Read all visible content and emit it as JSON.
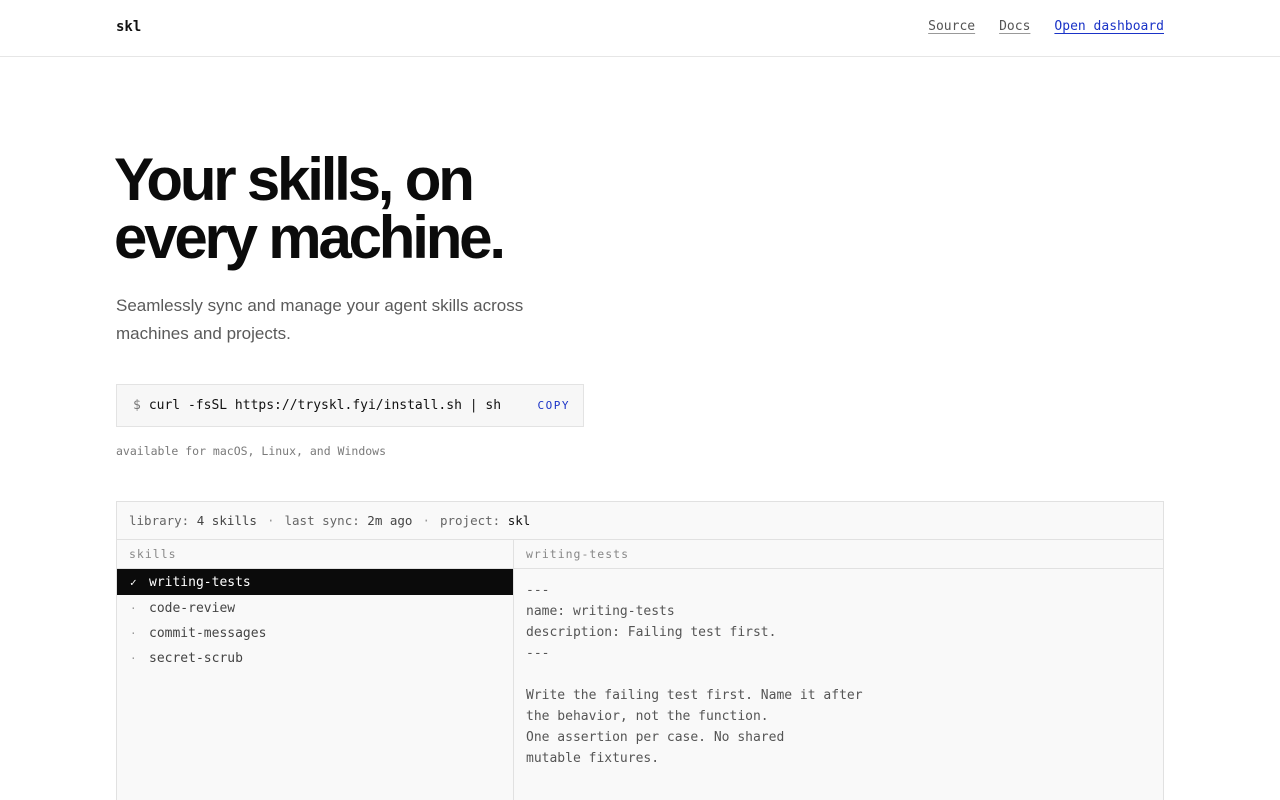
{
  "header": {
    "brand": "skl",
    "nav": [
      {
        "label": "Source"
      },
      {
        "label": "Docs"
      },
      {
        "label": "Open dashboard"
      }
    ]
  },
  "hero": {
    "title_line1": "Your skills, on",
    "title_line2": "every machine.",
    "subtitle": "Seamlessly sync and manage your agent skills across machines and projects."
  },
  "install": {
    "prompt": "$",
    "command": "curl -fsSL https://tryskl.fyi/install.sh | sh",
    "copy_label": "COPY",
    "availability": "available for macOS, Linux, and Windows"
  },
  "panel": {
    "status": {
      "library_label": "library:",
      "library_value": "4 skills",
      "sync_label": "last sync:",
      "sync_value": "2m ago",
      "project_label": "project:",
      "project_value": "skl",
      "separator": "·"
    },
    "skills_header": "skills",
    "skills": [
      {
        "mark": "✓",
        "name": "writing-tests"
      },
      {
        "mark": "·",
        "name": "code-review"
      },
      {
        "mark": "·",
        "name": "commit-messages"
      },
      {
        "mark": "·",
        "name": "secret-scrub"
      }
    ],
    "preview_header": "writing-tests",
    "preview_text": "---\nname: writing-tests\ndescription: Failing test first.\n---\n\nWrite the failing test first. Name it after\nthe behavior, not the function.\nOne assertion per case. No shared\nmutable fixtures."
  },
  "colors": {
    "accent": "#1a33c7",
    "selected_bg": "#0b0b0b"
  }
}
